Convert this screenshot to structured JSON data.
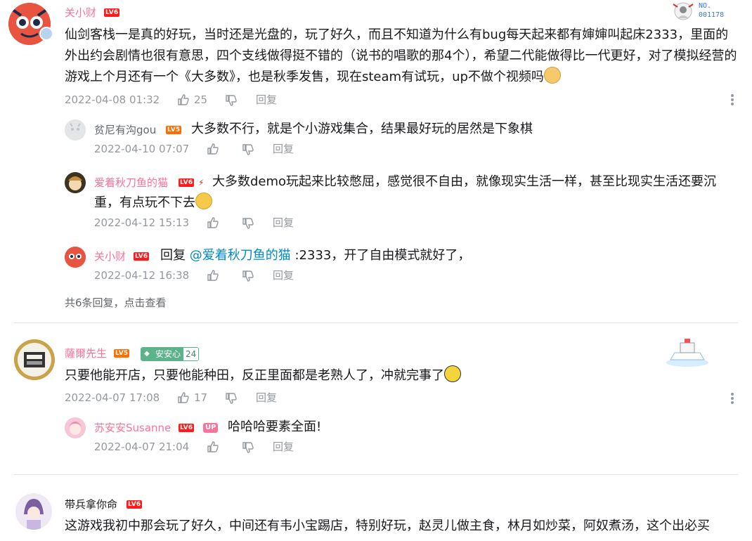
{
  "icons": {
    "like": "thumbs-up-icon",
    "dislike": "thumbs-down-icon",
    "more": "more-vertical-icon"
  },
  "comments": [
    {
      "user": "关小财",
      "level": "LV6",
      "badge_text": "NO.\n001178",
      "text": "仙剑客栈一是真的好玩，当时还是光盘的，玩了好久，而且不知道为什么有bug每天起来都有婶婶叫起床2333，里面的外出约会剧情也很有意思，四个支线做得挺不错的（说书的唱歌的那4个），希望二代能做得比一代更好，对了模拟经营的游戏上个月还有一个《大多数》，也是秋季发售，现在steam有试玩，up不做个视频吗",
      "time": "2022-04-08 01:32",
      "likes": "25",
      "reply_label": "回复",
      "replies": [
        {
          "user": "贫尼有沟gou",
          "level": "LV5",
          "text": "大多数不行，就是个小游戏集合，结果最好玩的居然是下象棋",
          "time": "2022-04-10 07:07",
          "reply_label": "回复"
        },
        {
          "user": "爱着秋刀鱼的猫",
          "level": "LV6",
          "text_line1": "大多数demo玩起来比较憋屈，感觉很不自由，就像现实生活一样，甚至比现实生活还要沉",
          "text_line2": "重，有点玩不下去",
          "time": "2022-04-12 15:13",
          "reply_label": "回复"
        },
        {
          "user": "关小财",
          "level": "LV6",
          "prefix": "回复",
          "mention": "@爱着秋刀鱼的猫",
          "text": ":2333，开了自由模式就好了，",
          "time": "2022-04-12 16:38",
          "reply_label": "回复"
        }
      ],
      "reply_summary": "共6条回复，点击查看"
    },
    {
      "user": "薩爾先生",
      "level": "LV5",
      "fan_badge": "安安心",
      "fan_level": "24",
      "text": "只要他能开店，只要他能种田，反正里面都是老熟人了，冲就完事了",
      "time": "2022-04-07 17:08",
      "likes": "17",
      "reply_label": "回复",
      "replies": [
        {
          "user": "苏安安Susanne",
          "level": "LV6",
          "up_tag": "UP",
          "text": "哈哈哈要素全面!",
          "time": "2022-04-07 21:04",
          "reply_label": "回复"
        }
      ]
    },
    {
      "user": "带兵拿你命",
      "level": "LV6",
      "text": "这游戏我初中那会玩了好久，中间还有韦小宝踢店，特别好玩，赵灵儿做主食，林月如炒菜，阿奴煮汤，这个出必买"
    }
  ]
}
